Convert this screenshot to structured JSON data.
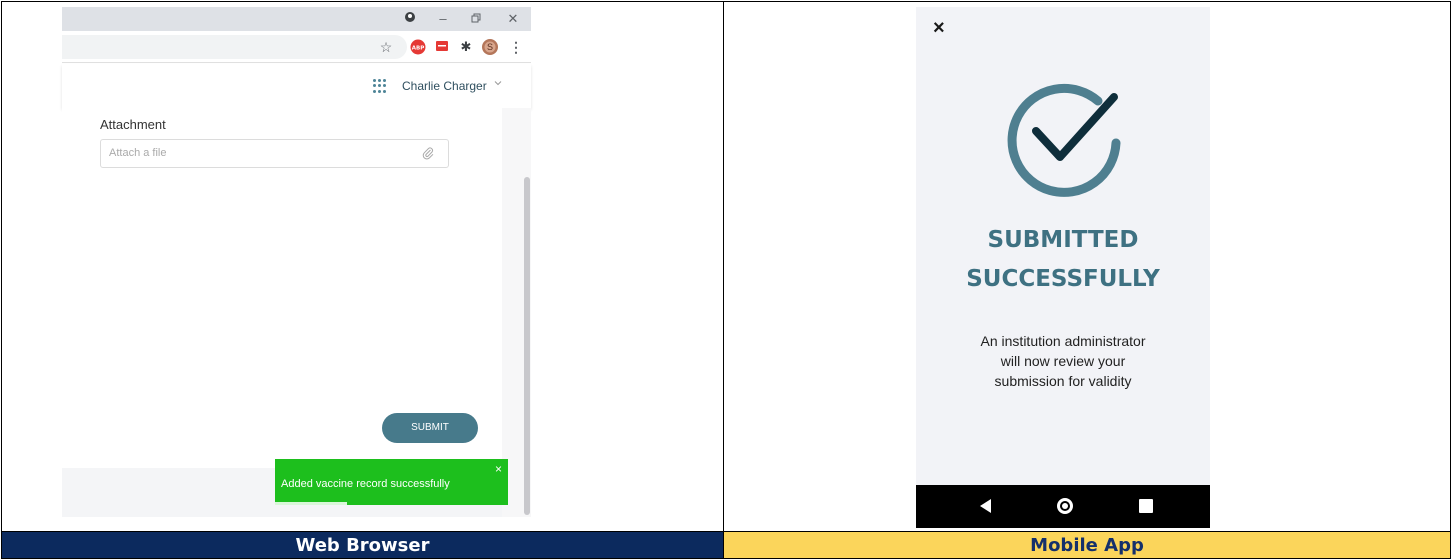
{
  "captions": {
    "web": "Web Browser",
    "mobile": "Mobile App"
  },
  "web": {
    "window_controls": {
      "profile_icon": "profile-dot-icon",
      "minimize": "minimize-icon",
      "restore": "restore-icon",
      "close": "close-icon"
    },
    "toolbar": {
      "icons": [
        "star-icon",
        "adblock-icon",
        "extension-red-icon",
        "puzzle-icon",
        "avatar-icon",
        "menu-kebab-icon"
      ],
      "avatar_letter": "S"
    },
    "header": {
      "apps_icon": "apps-grid-icon",
      "user_name": "Charlie Charger",
      "chevron": "chevron-down-icon"
    },
    "form": {
      "attachment_label": "Attachment",
      "attachment_placeholder": "Attach a file",
      "submit_label": "SUBMIT"
    },
    "toast": {
      "message": "Added vaccine record successfully",
      "close": "×"
    },
    "colors": {
      "accent": "#477a8b",
      "toast": "#1dbf1d"
    }
  },
  "mobile": {
    "close": "×",
    "title_line1": "SUBMITTED",
    "title_line2": "SUCCESSFULLY",
    "description_lines": [
      "An institution administrator",
      "will now review your",
      "submission for validity"
    ],
    "nav": {
      "back": "back-triangle-icon",
      "home": "home-circle-icon",
      "recents": "recents-square-icon"
    },
    "colors": {
      "accent": "#3e7182",
      "check": "#0f2e3b",
      "background": "#f2f3f7"
    }
  }
}
